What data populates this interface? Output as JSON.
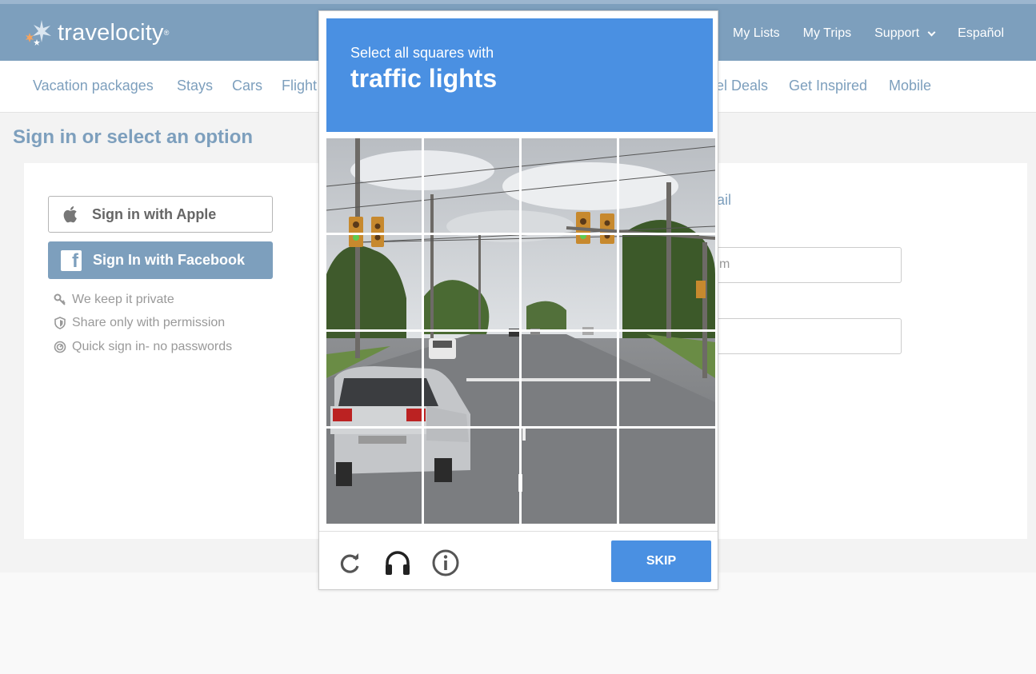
{
  "header": {
    "logo_text": "travelocity",
    "logo_mark": "®",
    "nav": [
      "My Lists",
      "My Trips",
      "Support",
      "Español"
    ]
  },
  "subnav": [
    "Vacation packages",
    "Stays",
    "Cars",
    "Flight",
    "el Deals",
    "Get Inspired",
    "Mobile"
  ],
  "page": {
    "title": "Sign in or select an option",
    "apple_button": "Sign in with Apple",
    "facebook_button": "Sign In with Facebook",
    "features": [
      "We keep it private",
      "Share only with permission",
      "Quick sign in- no passwords"
    ],
    "email_fragment": "ail",
    "input_fragment": "m"
  },
  "captcha": {
    "instruction": "Select all squares with",
    "target": "traffic lights",
    "skip_label": "SKIP",
    "icons": [
      "reload-icon",
      "audio-icon",
      "info-icon"
    ],
    "accent": "#4a90e2"
  }
}
